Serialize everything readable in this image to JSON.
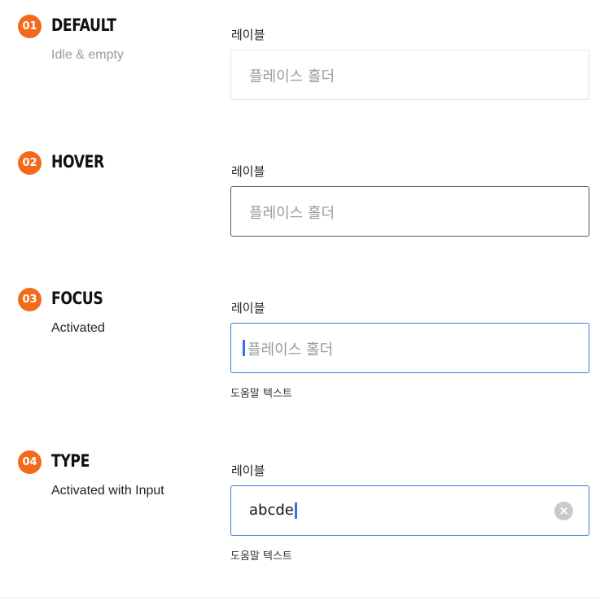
{
  "states": [
    {
      "number": "01",
      "title": "DEFAULT",
      "subtitle": "Idle & empty",
      "label": "레이블",
      "placeholder": "플레이스 홀더"
    },
    {
      "number": "02",
      "title": "HOVER",
      "label": "레이블",
      "placeholder": "플레이스 홀더"
    },
    {
      "number": "03",
      "title": "FOCUS",
      "subtitle": "Activated",
      "label": "레이블",
      "placeholder": "플레이스 홀더",
      "helper": "도움말 텍스트"
    },
    {
      "number": "04",
      "title": "TYPE",
      "subtitle": "Activated with Input",
      "label": "레이블",
      "value": "abcde",
      "helper": "도움말 텍스트",
      "clear_icon": "×"
    }
  ],
  "colors": {
    "badge": "#f26b1d",
    "focus_border": "#3a7bdc",
    "hover_border": "#555555",
    "default_border": "#e4e4e4",
    "caret": "#3a6ee8"
  }
}
